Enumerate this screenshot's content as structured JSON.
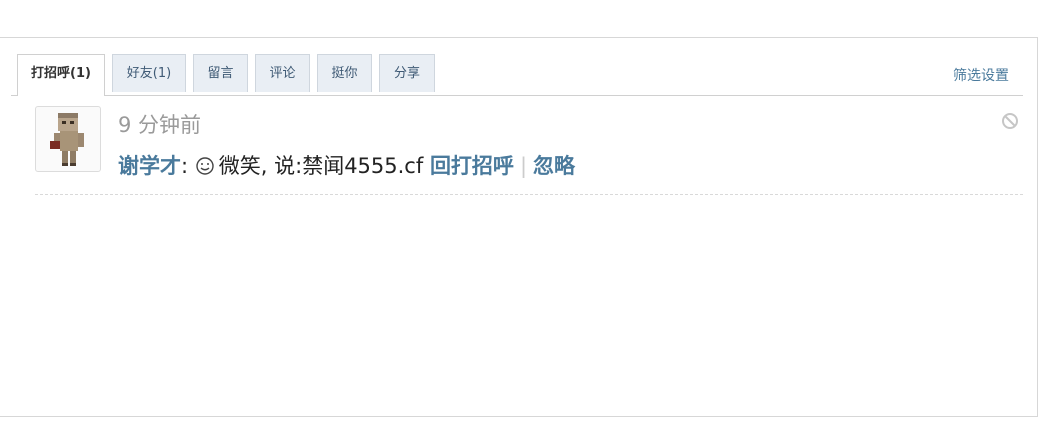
{
  "tabs": [
    {
      "label": "打招呼(1)",
      "active": true
    },
    {
      "label": "好友(1)",
      "active": false
    },
    {
      "label": "留言",
      "active": false
    },
    {
      "label": "评论",
      "active": false
    },
    {
      "label": "挺你",
      "active": false
    },
    {
      "label": "分享",
      "active": false
    }
  ],
  "filter_label": "筛选设置",
  "feed": {
    "time": "9 分钟前",
    "user_name": "谢学才",
    "colon": ":",
    "action_text": "微笑, 说:禁闻4555.cf",
    "reply_label": "回打招呼",
    "separator": "|",
    "ignore_label": "忽略",
    "smile_icon": "smile-icon",
    "block_icon": "block-icon",
    "avatar_icon": "blocky-character-avatar"
  },
  "colors": {
    "link": "#4a7a9c",
    "tab_bg": "#e9eef4"
  }
}
